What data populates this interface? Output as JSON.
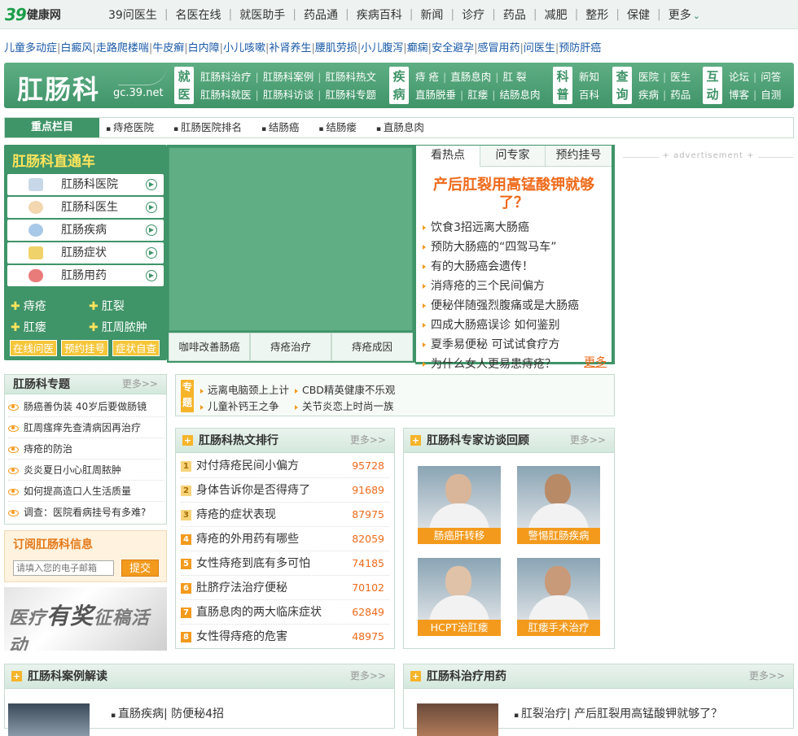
{
  "topnav": {
    "logo_num": "39",
    "logo_word": "健康网",
    "items": [
      "39问医生",
      "名医在线",
      "就医助手",
      "药品通",
      "疾病百科",
      "新闻",
      "诊疗",
      "药品",
      "减肥",
      "整形",
      "保健"
    ],
    "more": "更多"
  },
  "keywords": [
    "儿童多动症",
    "白癜风",
    "走路爬楼喘",
    "牛皮癣",
    "白内障",
    "小儿咳嗽",
    "补肾养生",
    "腰肌劳损",
    "小儿腹泻",
    "癫痫",
    "安全避孕",
    "感冒用药",
    "问医生",
    "预防肝癌"
  ],
  "header": {
    "logo": "肛肠科",
    "domain": "gc.39.net",
    "groups": [
      {
        "label_top": "就",
        "label_bottom": "医",
        "row1": [
          "肛肠科治疗",
          "肛肠科案例",
          "肛肠科热文"
        ],
        "row2": [
          "肛肠科就医",
          "肛肠科访谈",
          "肛肠科专题"
        ]
      },
      {
        "label_top": "疾",
        "label_bottom": "病",
        "row1": [
          "痔 疮",
          "直肠息肉",
          "肛 裂"
        ],
        "row2": [
          "直肠脱垂",
          "肛瘘",
          "结肠息肉"
        ]
      },
      {
        "label_top": "科",
        "label_bottom": "普",
        "row1": [
          "新知"
        ],
        "row2": [
          "百科"
        ]
      },
      {
        "label_top": "查",
        "label_bottom": "询",
        "row1": [
          "医院",
          "医生"
        ],
        "row2": [
          "疾病",
          "药品"
        ]
      },
      {
        "label_top": "互",
        "label_bottom": "动",
        "row1": [
          "论坛",
          "问答"
        ],
        "row2": [
          "博客",
          "自测"
        ]
      }
    ]
  },
  "focus": {
    "label": "重点栏目",
    "links": [
      "痔疮医院",
      "肛肠医院排名",
      "结肠癌",
      "结肠瘘",
      "直肠息肉"
    ]
  },
  "left_panel": {
    "title": "肛肠科直通车",
    "items": [
      "肛肠科医院",
      "肛肠科医生",
      "肛肠疾病",
      "肛肠症状",
      "肛肠用药"
    ],
    "small": [
      "痔疮",
      "肛裂",
      "肛瘘",
      "肛周脓肿"
    ],
    "buttons": [
      "在线问医",
      "预约挂号",
      "症状自查"
    ]
  },
  "center": {
    "tabs": [
      "咖啡改善肠癌",
      "痔疮治疗",
      "痔疮成因"
    ]
  },
  "right_panel": {
    "tabs": [
      "看热点",
      "问专家",
      "预约挂号"
    ],
    "headline": "产后肛裂用高锰酸钾就够了？",
    "list": [
      "饮食3招远离大肠癌",
      "预防大肠癌的“四驾马车”",
      "有的大肠癌会遗传！",
      "消痔疮的三个民间偏方",
      "便秘伴随强烈腹痛或是大肠癌",
      "四成大肠癌误诊  如何鉴别",
      "夏季易便秘  可试试食疗方",
      "为什么女人更易患痔疮？"
    ],
    "more": "更多"
  },
  "ad_label": "advertisement",
  "specials": {
    "title": "肛肠科专题",
    "more": "更多>>",
    "items": [
      "肠癌善伪装  40岁后要做肠镜",
      "肛周瘙痒先查清病因再治疗",
      "痔疮的防治",
      "炎炎夏日小心肛周脓肿",
      "如何提高造口人生活质量",
      "调查：医院看病挂号有多难?"
    ]
  },
  "subscribe": {
    "title": "订阅肛肠科信息",
    "placeholder": "请填入您的电子邮箱",
    "button": "提交"
  },
  "banner": {
    "text_a": "医疗",
    "text_b": "有奖",
    "text_c": "征稿活动"
  },
  "zhuanti": {
    "label": "专题",
    "links": [
      "远离电脑颈上上计",
      "CBD精英健康不乐观",
      "儿童补钙王之争",
      "关节炎恋上时尚一族"
    ]
  },
  "ranking": {
    "title": "肛肠科热文排行",
    "more": "更多>>",
    "rows": [
      {
        "no": "1",
        "title": "对付痔疮民间小偏方",
        "count": "95728"
      },
      {
        "no": "2",
        "title": "身体告诉你是否得痔了",
        "count": "91689"
      },
      {
        "no": "3",
        "title": "痔疮的症状表现",
        "count": "87975"
      },
      {
        "no": "4",
        "title": "痔疮的外用药有哪些",
        "count": "82059"
      },
      {
        "no": "5",
        "title": "女性痔疮到底有多可怕",
        "count": "74185"
      },
      {
        "no": "6",
        "title": "肚脐疗法治疗便秘",
        "count": "70102"
      },
      {
        "no": "7",
        "title": "直肠息肉的两大临床症状",
        "count": "62849"
      },
      {
        "no": "8",
        "title": "女性得痔疮的危害",
        "count": "48975"
      }
    ]
  },
  "experts": {
    "title": "肛肠科专家访谈回顾",
    "more": "更多>>",
    "items": [
      "肠癌肝转移",
      "警惕肛肠疾病",
      "HCPT治肛瘘",
      "肛瘘手术治疗"
    ]
  },
  "cases": {
    "title": "肛肠科案例解读",
    "more": "更多>>",
    "first": "直肠疾病| 防便秘4招"
  },
  "drugs": {
    "title": "肛肠科治疗用药",
    "more": "更多>>",
    "first": "肛裂治疗| 产后肛裂用高锰酸钾就够了？"
  }
}
